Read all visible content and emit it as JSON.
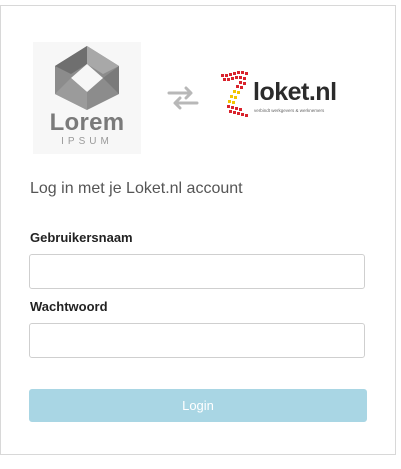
{
  "client_logo": {
    "name": "Lorem",
    "sub": "IPSUM"
  },
  "swap_icon": "swap-arrows-icon",
  "loket_logo": {
    "name": "loket.nl",
    "tagline": "verbindt werkgevers & werknemers"
  },
  "heading": "Log in met je Loket.nl account",
  "form": {
    "username_label": "Gebruikersnaam",
    "username_value": "",
    "password_label": "Wachtwoord",
    "password_value": "",
    "login_label": "Login"
  },
  "colors": {
    "login_button": "#a9d6e4",
    "loket_red": "#d9232d",
    "loket_yellow": "#f2c500"
  }
}
